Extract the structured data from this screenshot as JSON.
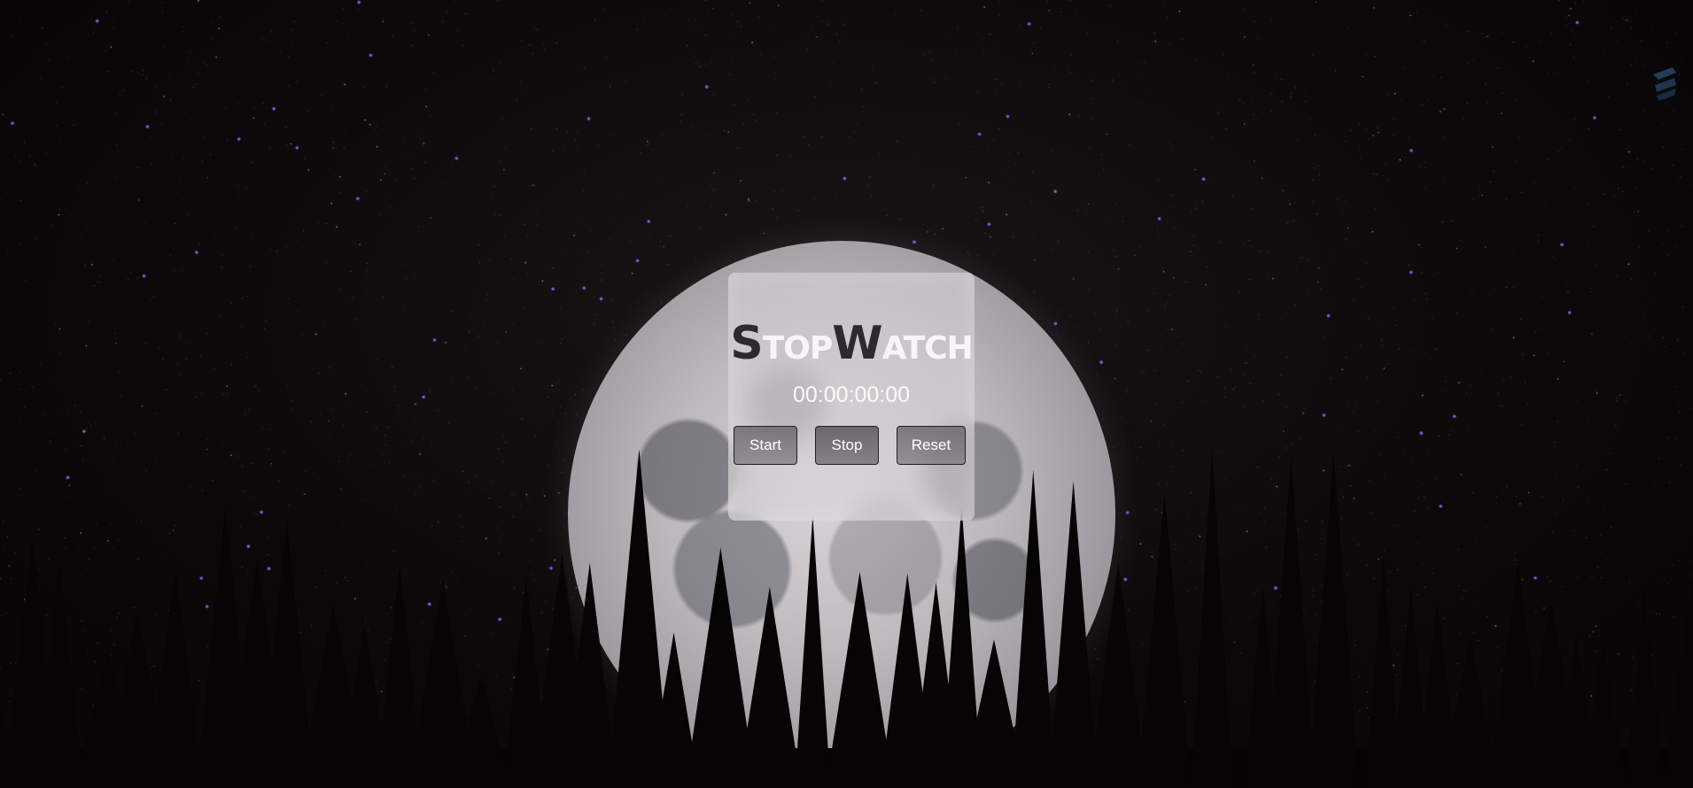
{
  "app": {
    "title_first_letter_1": "S",
    "title_rest_1": "top",
    "title_first_letter_2": "W",
    "title_rest_2": "atch"
  },
  "timer": {
    "display": "00:00:00:00"
  },
  "controls": {
    "start_label": "Start",
    "stop_label": "Stop",
    "reset_label": "Reset"
  },
  "colors": {
    "card_background": "#d7d2d6",
    "title_dark": "#2d2a2e",
    "title_light": "#f7f5f7",
    "button_border": "#232024",
    "sky": "#0c0809",
    "star_accent": "#8a5cff"
  },
  "icons": {
    "corner": "logo-icon"
  }
}
